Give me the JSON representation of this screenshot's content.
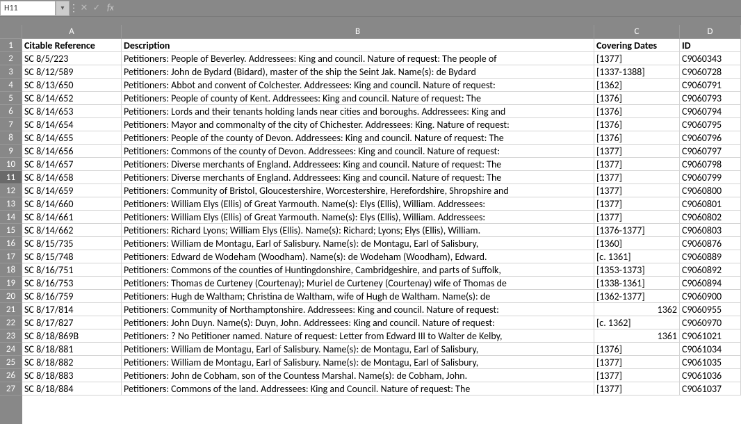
{
  "nameBox": "H11",
  "formula": "",
  "colHeaders": [
    "A",
    "B",
    "C",
    "D"
  ],
  "tableHeaders": {
    "A": "Citable Reference",
    "B": "Description",
    "C": "Covering Dates",
    "D": "ID"
  },
  "rows": [
    {
      "n": 1
    },
    {
      "n": 2,
      "A": "SC 8/5/223",
      "B": "Petitioners: People of Beverley. Addressees: King and council. Nature of request: The people of",
      "C": "[1377]",
      "D": "C9060343"
    },
    {
      "n": 3,
      "A": "SC 8/12/589",
      "B": "Petitioners: John de Bydard (Bidard), master of the ship the Seint Jak. Name(s): de Bydard",
      "C": "[1337-1388]",
      "D": "C9060728"
    },
    {
      "n": 4,
      "A": "SC 8/13/650",
      "B": "Petitioners: Abbot and convent of Colchester. Addressees: King and council. Nature of request:",
      "C": "[1362]",
      "D": "C9060791"
    },
    {
      "n": 5,
      "A": "SC 8/14/652",
      "B": "Petitioners: People of county of Kent. Addressees: King and council. Nature of request: The",
      "C": "[1376]",
      "D": "C9060793"
    },
    {
      "n": 6,
      "A": "SC 8/14/653",
      "B": "Petitioners: Lords and their tenants holding lands near cities and boroughs. Addressees: King and",
      "C": "[1376]",
      "D": "C9060794"
    },
    {
      "n": 7,
      "A": "SC 8/14/654",
      "B": "Petitioners: Mayor and commonalty of the city of Chichester. Addressees: King. Nature of request:",
      "C": "[1376]",
      "D": "C9060795"
    },
    {
      "n": 8,
      "A": "SC 8/14/655",
      "B": "Petitioners: People of the county of Devon. Addressees: King and council. Nature of request: The",
      "C": "[1376]",
      "D": "C9060796"
    },
    {
      "n": 9,
      "A": "SC 8/14/656",
      "B": "Petitioners: Commons of the county of Devon. Addressees: King and council. Nature of request:",
      "C": "[1377]",
      "D": "C9060797"
    },
    {
      "n": 10,
      "A": "SC 8/14/657",
      "B": "Petitioners: Diverse merchants of England. Addressees: King and council. Nature of request: The",
      "C": "[1377]",
      "D": "C9060798"
    },
    {
      "n": 11,
      "A": "SC 8/14/658",
      "B": "Petitioners: Diverse merchants of England. Addressees: King and council. Nature of request: The",
      "C": "[1377]",
      "D": "C9060799"
    },
    {
      "n": 12,
      "A": "SC 8/14/659",
      "B": "Petitioners: Community of Bristol, Gloucestershire, Worcestershire, Herefordshire, Shropshire and",
      "C": "[1377]",
      "D": "C9060800"
    },
    {
      "n": 13,
      "A": "SC 8/14/660",
      "B": "Petitioners: William Elys (Ellis) of Great Yarmouth. Name(s): Elys (Ellis), William. Addressees:",
      "C": "[1377]",
      "D": "C9060801"
    },
    {
      "n": 14,
      "A": "SC 8/14/661",
      "B": "Petitioners: William Elys (Ellis) of Great Yarmouth. Name(s): Elys (Ellis), William. Addressees:",
      "C": "[1377]",
      "D": "C9060802"
    },
    {
      "n": 15,
      "A": "SC 8/14/662",
      "B": "Petitioners: Richard Lyons; William Elys (Ellis). Name(s): Richard; Lyons; Elys (Ellis), William.",
      "C": "[1376-1377]",
      "D": "C9060803"
    },
    {
      "n": 16,
      "A": "SC 8/15/735",
      "B": "Petitioners: William de Montagu, Earl of Salisbury. Name(s): de Montagu, Earl of Salisbury,",
      "C": "[1360]",
      "D": "C9060876"
    },
    {
      "n": 17,
      "A": "SC 8/15/748",
      "B": "Petitioners: Edward de Wodeham (Woodham). Name(s): de Wodeham (Woodham), Edward.",
      "C": "[c. 1361]",
      "D": "C9060889"
    },
    {
      "n": 18,
      "A": "SC 8/16/751",
      "B": "Petitioners: Commons of the counties of Huntingdonshire, Cambridgeshire, and parts of Suffolk,",
      "C": "[1353-1373]",
      "D": "C9060892"
    },
    {
      "n": 19,
      "A": "SC 8/16/753",
      "B": "Petitioners: Thomas de Curteney (Courtenay); Muriel de Curteney (Courtenay) wife of Thomas de",
      "C": "[1338-1361]",
      "D": "C9060894"
    },
    {
      "n": 20,
      "A": "SC 8/16/759",
      "B": "Petitioners: Hugh de Waltham; Christina de Waltham, wife of Hugh de Waltham. Name(s): de",
      "C": "[1362-1377]",
      "D": "C9060900"
    },
    {
      "n": 21,
      "A": "SC 8/17/814",
      "B": "Petitioners: Community of Northamptonshire. Addressees: King and council. Nature of request:",
      "C": "1362",
      "Cnum": true,
      "D": "C9060955"
    },
    {
      "n": 22,
      "A": "SC 8/17/827",
      "B": "Petitioners: John Duyn. Name(s): Duyn, John. Addressees: King and council. Nature of request:",
      "C": "[c. 1362]",
      "D": "C9060970"
    },
    {
      "n": 23,
      "A": "SC 8/18/869B",
      "B": "Petitioners: ? No Petitioner named. Nature of request: Letter from Edward III to Walter de Kelby,",
      "C": "1361",
      "Cnum": true,
      "D": "C9061021"
    },
    {
      "n": 24,
      "A": "SC 8/18/881",
      "B": "Petitioners: William de Montagu, Earl of Salisbury. Name(s): de Montagu, Earl of Salisbury,",
      "C": "[1376]",
      "D": "C9061034"
    },
    {
      "n": 25,
      "A": "SC 8/18/882",
      "B": "Petitioners: William de Montagu, Earl of Salisbury. Name(s): de Montagu, Earl of Salisbury,",
      "C": "[1377]",
      "D": "C9061035"
    },
    {
      "n": 26,
      "A": "SC 8/18/883",
      "B": "Petitioners: John de Cobham, son of the Countess Marshal. Name(s): de Cobham, John.",
      "C": "[1377]",
      "D": "C9061036"
    },
    {
      "n": 27,
      "A": "SC 8/18/884",
      "B": "Petitioners: Commons of the land. Addressees: King and Council. Nature of request: The",
      "C": "[1377]",
      "D": "C9061037"
    }
  ],
  "selectedRow": 11
}
